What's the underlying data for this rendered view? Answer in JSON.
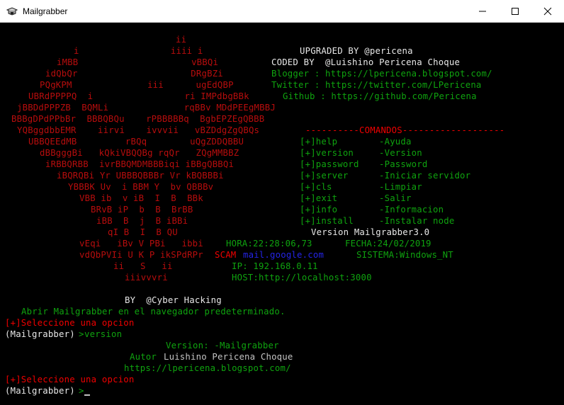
{
  "window": {
    "title": "Mailgrabber",
    "app_icon": "mailgrabber-app-icon",
    "controls": [
      "minimize-icon",
      "maximize-icon",
      "close-icon"
    ]
  },
  "console": {
    "banner_art": [
      "ii",
      "i                 iiii i",
      "iMBB                     vBBQi",
      "idQbQr                     DRgBZi",
      "PQgKPM              iii      ugEdQBP",
      "UBRdPPPPQ  i                 ri IMPdbgBBk",
      "jBBDdPPPZB  BQMLi              rqBBv MDdPEEgMBBJ",
      "BBBgDPdPPbBr  BBBQBQu    rPBBBBBq  BgbEPZEgQBBB",
      "YQBggdbbEMR    iirvi    ivvvii   vBZDdgZgQBQs",
      "UBBQEEdMB         rBQq        uQgZDDQBBU",
      "dBBgggBi   kQkiVBQQBg rqQr   ZQgMMBBZ",
      "iRBBQRBB  ivrBBQMDMBBBiqi iBBgQBBQi",
      "iBQRQBi Yr UBBBQBBBr Vr kBQBBBi",
      "YBBBK Uv  i BBM Y  bv QBBBv",
      "VBB ib  v iB  I  B  BBk",
      "BRvB iP  b  B  BrBB",
      "iBB  B  j  B iBBi",
      "qI B  I  B QU",
      "vEqi   iBv V PBi   ibbi",
      "vdQbPVIi U K P ikSPdRPr",
      "ii   S   ii",
      "iiivvvri"
    ],
    "info": {
      "upgraded_by": "UPGRADED BY @pericena",
      "coded_by": "CODED BY  @Luishino Pericena Choque",
      "blogger": "Blogger : https://lpericena.blogspot.com/",
      "twitter": "Twitter : https://twitter.com/LPericena",
      "github": "Github : https://github.com/Pericena"
    },
    "menu_header": "----------COMANDOS-------------------",
    "menu": [
      {
        "cmd": "[+]help",
        "desc": "-Ayuda"
      },
      {
        "cmd": "[+]version",
        "desc": "-Version"
      },
      {
        "cmd": "[+]password",
        "desc": "-Password"
      },
      {
        "cmd": "[+]server",
        "desc": "-Iniciar servidor"
      },
      {
        "cmd": "[+]cls",
        "desc": "-Limpiar"
      },
      {
        "cmd": "[+]exit",
        "desc": "-Salir"
      },
      {
        "cmd": "[+]info",
        "desc": "-Informacion"
      },
      {
        "cmd": "[+]install",
        "desc": "-Instalar node"
      }
    ],
    "version_line": "Version Mailgrabber3.0",
    "status": {
      "hora": "HORA:22:28:06,73",
      "fecha": "FECHA:24/02/2019",
      "scam_label": "SCAM",
      "scam_target": "mail.google.com",
      "sistema": "SISTEMA:Windows_NT",
      "ip": "IP: 192.168.0.11",
      "host": "HOST:http://localhost:3000"
    },
    "by_line": "BY  @Cyber Hacking",
    "open_msg": "Abrir Mailgrabber en el navegador predeterminado.",
    "prompt_select": "[+]Seleccione una opcion",
    "prompt": "(Mailgrabber)",
    "prompt_arrow": ">",
    "entered_command": "version",
    "version_output": {
      "version": "Version: -Mailgrabber",
      "autor_label": "Autor",
      "autor_name": "Luishino Pericena Choque",
      "url": "https://lpericena.blogspot.com/"
    }
  }
}
